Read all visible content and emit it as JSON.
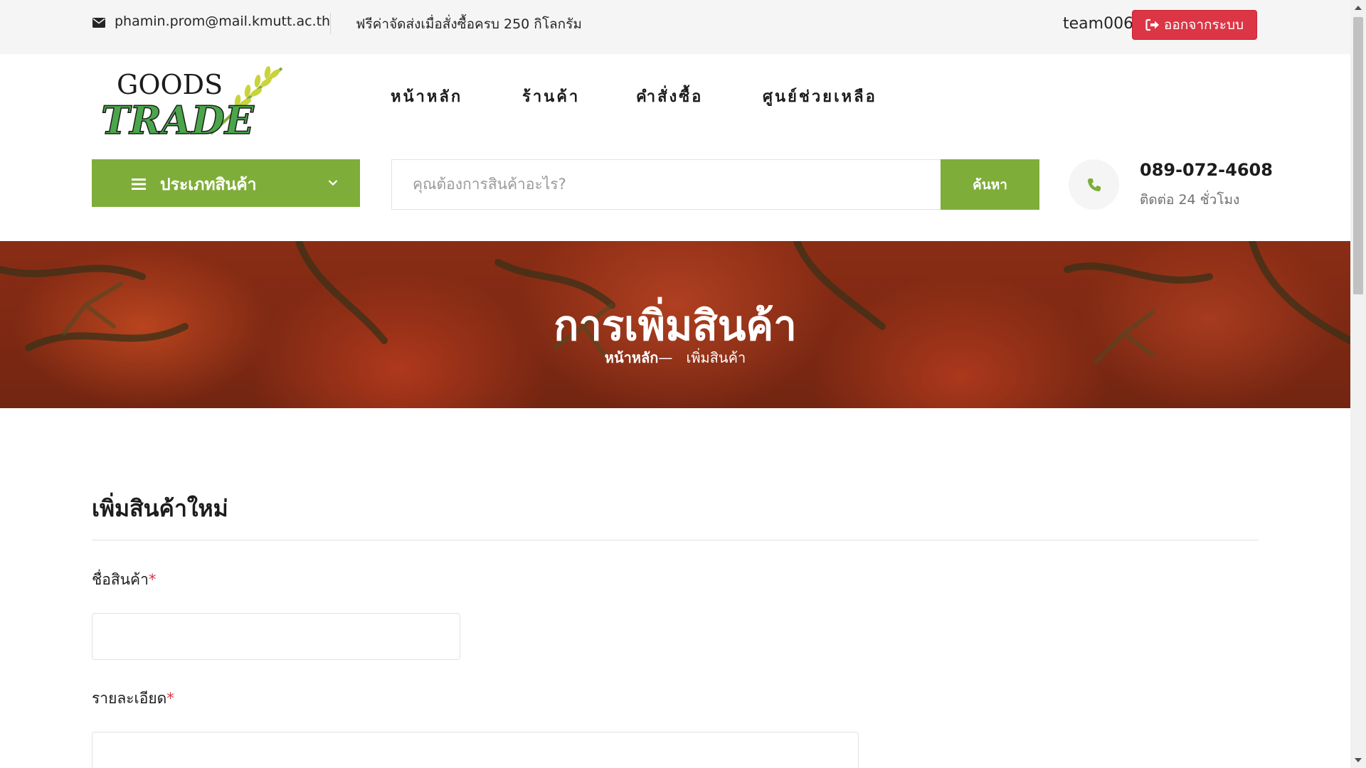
{
  "topbar": {
    "email": "phamin.prom@mail.kmutt.ac.th",
    "shipping_note": "ฟรีค่าจัดส่งเมื่อสั่งซื้อครบ 250 กิโลกรัม",
    "username": "team006",
    "logout_label": "ออกจากระบบ",
    "logout_icon": "sign-out-icon"
  },
  "logo": {
    "line1": "GOODS",
    "line2": "TRADE"
  },
  "nav": {
    "items": [
      {
        "label": "หน้าหลัก"
      },
      {
        "label": "ร้านค้า"
      },
      {
        "label": "คำสั่งซื้อ"
      },
      {
        "label": "ศูนย์ช่วยเหลือ"
      }
    ]
  },
  "categories": {
    "label": "ประเภทสินค้า"
  },
  "search": {
    "placeholder": "คุณต้องการสินค้าอะไร?",
    "button_label": "ค้นหา"
  },
  "contact": {
    "phone": "089-072-4608",
    "note": "ติดต่อ 24 ชั่วโมง"
  },
  "hero": {
    "title": "การเพิ่มสินค้า",
    "breadcrumb_home": "หน้าหลัก",
    "breadcrumb_sep": "—",
    "breadcrumb_current": "เพิ่มสินค้า"
  },
  "form": {
    "title": "เพิ่มสินค้าใหม่",
    "fields": [
      {
        "label": "ชื่อสินค้า",
        "required_mark": "*",
        "value": ""
      },
      {
        "label": "รายละเอียด",
        "required_mark": "*",
        "value": ""
      }
    ]
  },
  "colors": {
    "accent_green": "#7fad39",
    "logout_red": "#dc3545",
    "topbar_bg": "#f5f5f5"
  }
}
